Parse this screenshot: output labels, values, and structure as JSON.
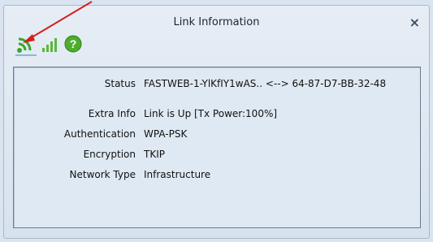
{
  "window": {
    "title": "Link Information",
    "close_glyph": "×"
  },
  "toolbar": {
    "icons": [
      "wifi-signal-icon",
      "signal-strength-icon",
      "help-icon"
    ],
    "help_glyph": "?",
    "accent_green": "#4cae2c"
  },
  "info": {
    "status": {
      "label": "Status",
      "value": "FASTWEB-1-YlKfIY1wAS.. <--> 64-87-D7-BB-32-48"
    },
    "extra_info": {
      "label": "Extra Info",
      "value": "Link is Up  [Tx Power:100%]"
    },
    "authentication": {
      "label": "Authentication",
      "value": "WPA-PSK"
    },
    "encryption": {
      "label": "Encryption",
      "value": "TKIP"
    },
    "network_type": {
      "label": "Network Type",
      "value": "Infrastructure"
    }
  },
  "annotation": {
    "arrow_color": "#d42020"
  }
}
